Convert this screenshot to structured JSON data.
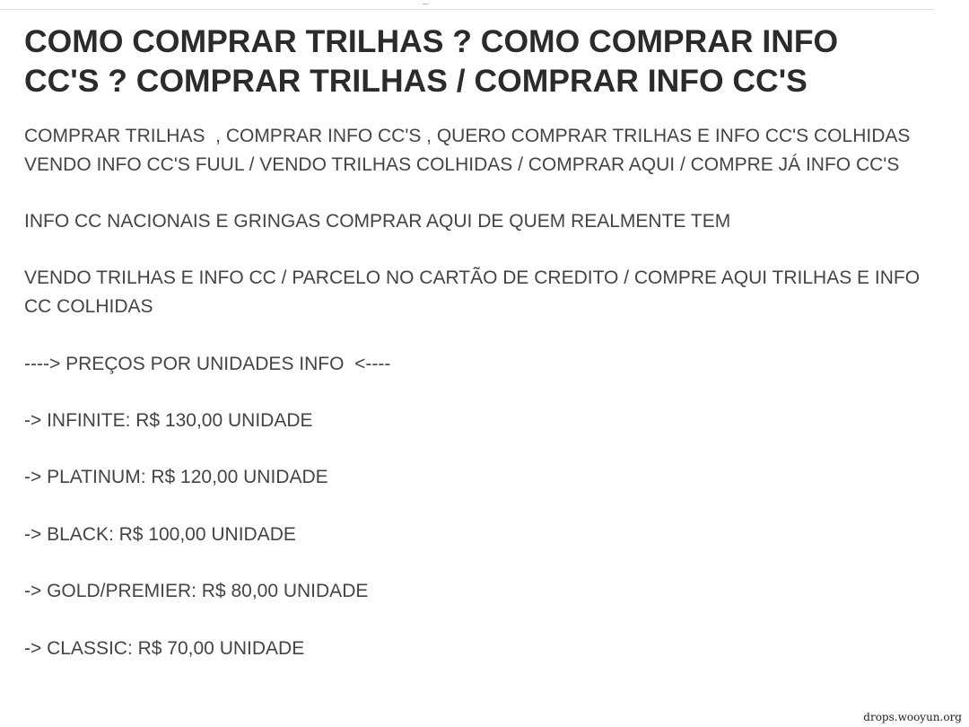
{
  "title": "COMO COMPRAR TRILHAS ? COMO COMPRAR INFO CC'S ? COMPRAR TRILHAS / COMPRAR INFO CC'S",
  "intro_lines": [
    "COMPRAR TRILHAS  , COMPRAR INFO CC'S , QUERO COMPRAR TRILHAS E INFO CC'S COLHIDAS",
    "VENDO INFO CC'S FUUL / VENDO TRILHAS COLHIDAS / COMPRAR AQUI / COMPRE JÁ INFO CC'S"
  ],
  "nacionais_line": "INFO CC NACIONAIS E GRINGAS COMPRAR AQUI DE QUEM REALMENTE TEM",
  "parcelo_line": "VENDO TRILHAS E INFO CC / PARCELO NO CARTÃO DE CREDITO / COMPRE AQUI TRILHAS E INFO CC COLHIDAS",
  "prices_heading": "----> PREÇOS POR UNIDADES INFO  <----",
  "prices": [
    "-> INFINITE: R$ 130,00 UNIDADE",
    "-> PLATINUM: R$ 120,00 UNIDADE",
    "-> BLACK: R$ 100,00 UNIDADE",
    "-> GOLD/PREMIER: R$ 80,00 UNIDADE",
    "-> CLASSIC: R$ 70,00 UNIDADE"
  ],
  "watermark": "drops.wooyun.org"
}
